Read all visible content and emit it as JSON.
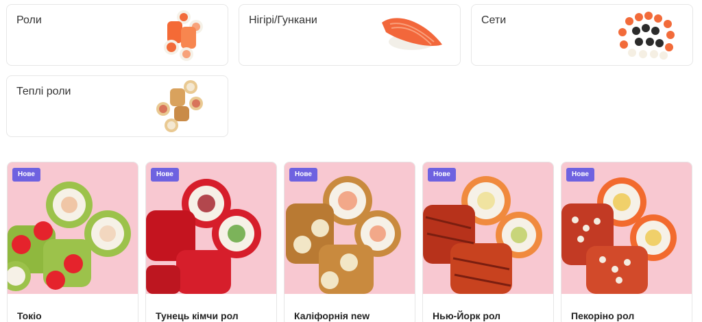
{
  "categories": [
    {
      "label": "Роли"
    },
    {
      "label": "Нігірі/Гункани"
    },
    {
      "label": "Сети"
    },
    {
      "label": "Теплі роли"
    }
  ],
  "products": [
    {
      "badge": "Нове",
      "name": "Токіо"
    },
    {
      "badge": "Нове",
      "name": "Тунець кімчи рол"
    },
    {
      "badge": "Нове",
      "name": "Каліфорнія new"
    },
    {
      "badge": "Нове",
      "name": "Нью-Йорк рол"
    },
    {
      "badge": "Нове",
      "name": "Пекоріно рол"
    }
  ],
  "colors": {
    "badge": "#6e62e0",
    "photo_bg": "#f8c8d1",
    "card_border": "#e6e6e6"
  }
}
